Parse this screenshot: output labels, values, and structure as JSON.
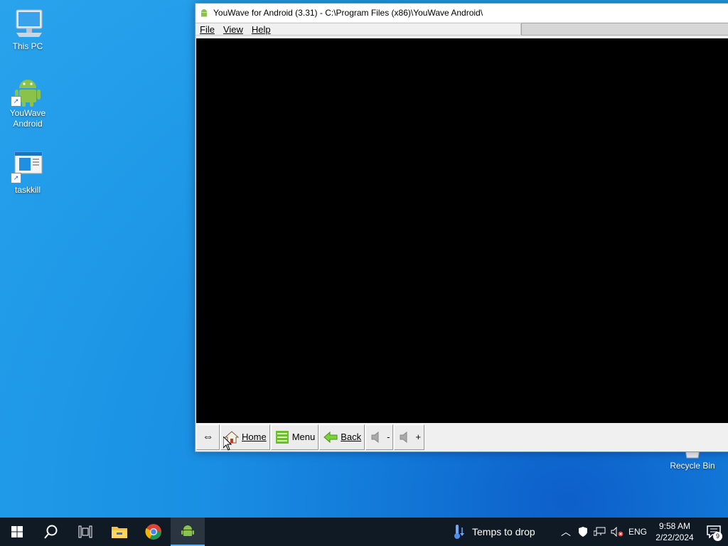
{
  "desktop": {
    "icons": [
      {
        "label": "This PC"
      },
      {
        "label": "YouWave Android"
      },
      {
        "label": "taskkill"
      },
      {
        "label": "Recycle Bin"
      }
    ]
  },
  "window": {
    "title": "YouWave for Android (3.31) - C:\\Program Files (x86)\\YouWave Android\\",
    "menu": {
      "file": "File",
      "view": "View",
      "help": "Help"
    },
    "toolbar": {
      "rotate": "⇔",
      "home": "Home",
      "menu": "Menu",
      "back": "Back",
      "vol_down": "-",
      "vol_up": "+"
    }
  },
  "taskbar": {
    "weather": "Temps to drop",
    "language": "ENG",
    "time": "9:58 AM",
    "date": "2/22/2024",
    "notifications": "9"
  },
  "colors": {
    "accent": "#1a8fe3",
    "taskbar": "#101a24",
    "android_green": "#8bc34a"
  }
}
